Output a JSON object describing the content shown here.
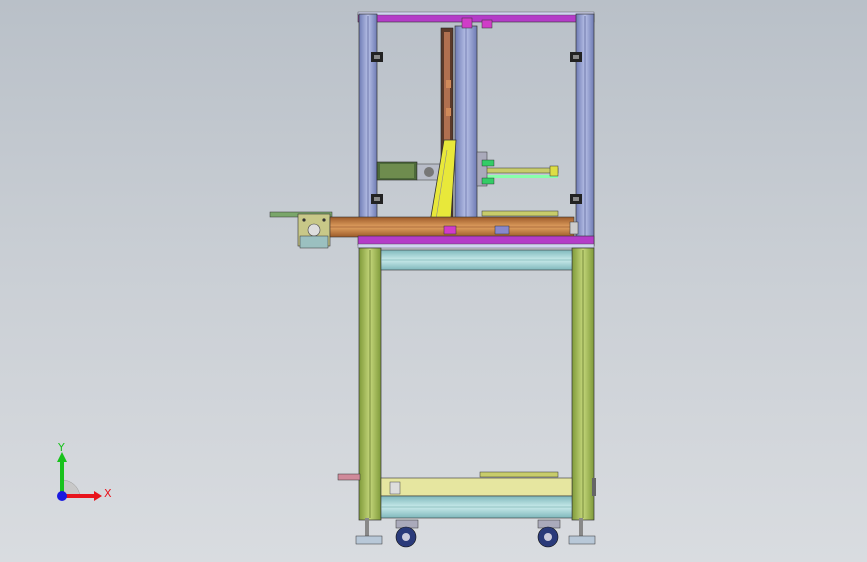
{
  "app": "3D CAD viewport",
  "triad": {
    "x_label": "X",
    "y_label": "Y",
    "x_color": "#e8141c",
    "y_color": "#18c21c",
    "z_color": "#1a1ae0"
  },
  "colors": {
    "background_top": "#b9c0c8",
    "background_bottom": "#d9dce0",
    "upper_frame": "#8f9ac8",
    "lower_frame": "#a6bd5a",
    "magenta_parts": "#b43cc8",
    "orange_rail": "#c98a4a",
    "cyan_plates": "#a8d4d4",
    "yellow_support": "#e8e83a"
  },
  "icons": [
    "coordinate-triad-icon"
  ]
}
